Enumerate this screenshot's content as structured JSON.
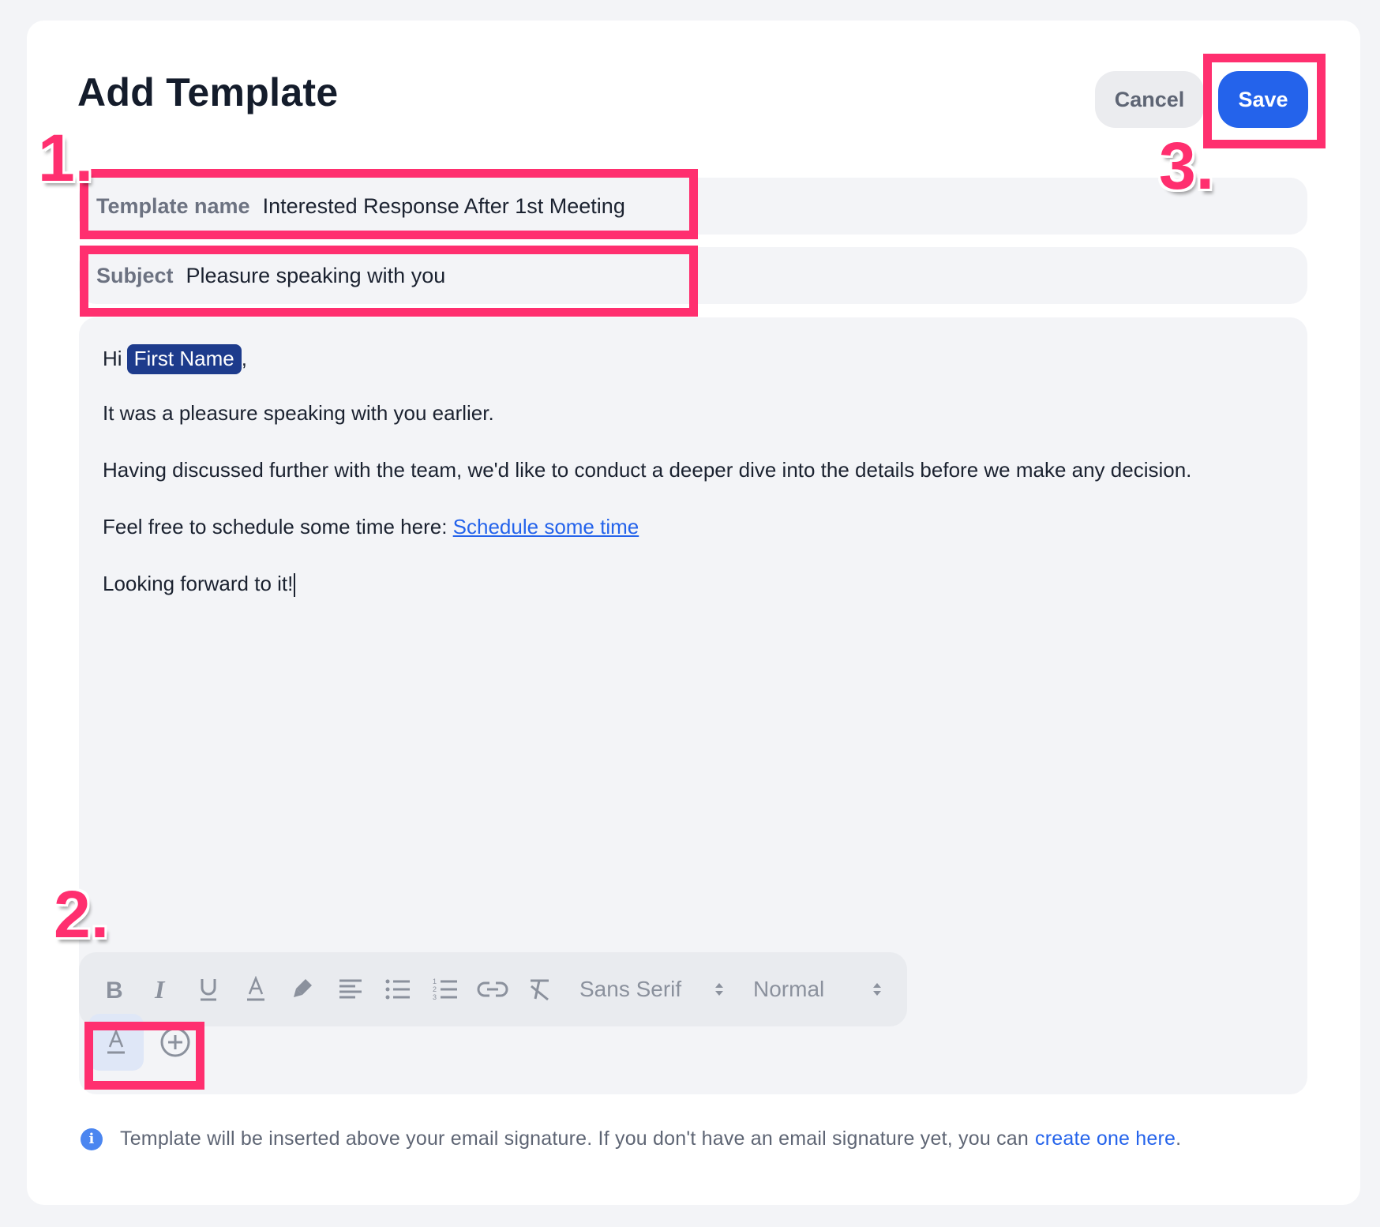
{
  "header": {
    "title": "Add Template"
  },
  "actions": {
    "cancel_label": "Cancel",
    "save_label": "Save"
  },
  "fields": {
    "template_name": {
      "label": "Template name",
      "value": "Interested Response After 1st Meeting"
    },
    "subject": {
      "label": "Subject",
      "value": "Pleasure speaking with you"
    }
  },
  "body": {
    "greeting_prefix": "Hi",
    "placeholder_chip": "First Name",
    "greeting_suffix": ",",
    "line1": "It was a pleasure speaking with you earlier.",
    "line2": "Having discussed further with the team, we'd like to conduct a deeper dive into the details before we make any decision.",
    "line3_prefix": "Feel free to schedule some time here: ",
    "line3_link": "Schedule some time",
    "line4": "Looking forward to it!"
  },
  "toolbar": {
    "icons": [
      "bold-icon",
      "italic-icon",
      "underline-icon",
      "text-color-icon",
      "highlight-icon",
      "align-icon",
      "bullet-list-icon",
      "numbered-list-icon",
      "link-icon",
      "clear-format-icon"
    ],
    "font_family": "Sans Serif",
    "font_size": "Normal"
  },
  "extras": {
    "icons": [
      "text-format-icon",
      "add-icon"
    ]
  },
  "info": {
    "text": "Template will be inserted above your email signature. If you don't have an email signature yet, you can",
    "link": "create one here",
    "suffix": "."
  },
  "annotations": {
    "step1": "1.",
    "step2": "2.",
    "step3": "3."
  },
  "colors": {
    "accent": "#2463eb",
    "chip": "#1d3b8c",
    "highlight": "#ff2f6f"
  }
}
